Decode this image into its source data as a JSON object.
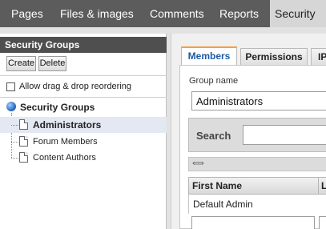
{
  "nav": {
    "tabs": [
      {
        "label": "Pages"
      },
      {
        "label": "Files & images"
      },
      {
        "label": "Comments"
      },
      {
        "label": "Reports"
      },
      {
        "label": "Security"
      }
    ],
    "active": "Security"
  },
  "left_panel": {
    "title": "Security Groups",
    "create_label": "Create",
    "delete_label": "Delete",
    "drag_drop_label": "Allow drag & drop reordering",
    "drag_drop_checked": false,
    "tree": {
      "root_label": "Security Groups",
      "root_icon": "globe-icon",
      "items": [
        {
          "label": "Administrators",
          "selected": true
        },
        {
          "label": "Forum Members",
          "selected": false
        },
        {
          "label": "Content Authors",
          "selected": false
        }
      ]
    }
  },
  "right_panel": {
    "tabs": [
      {
        "label": "Members"
      },
      {
        "label": "Permissions"
      },
      {
        "label": "IP"
      }
    ],
    "active_tab": "Members",
    "group_name_label": "Group name",
    "group_name_value": "Administrators",
    "search_label": "Search",
    "search_value": "",
    "reorder_icon": "⇚⇛",
    "members_grid": {
      "columns": [
        "First Name",
        "L"
      ],
      "rows": [
        [
          "Default Admin",
          ""
        ]
      ]
    }
  },
  "colors": {
    "nav_bg": "#5c5c5c",
    "panel_header_bg": "#4f4f4f",
    "active_tab_text": "#1d5aa3",
    "active_tab_accent": "#f0a340",
    "selection_bg": "#e3e8f3"
  }
}
